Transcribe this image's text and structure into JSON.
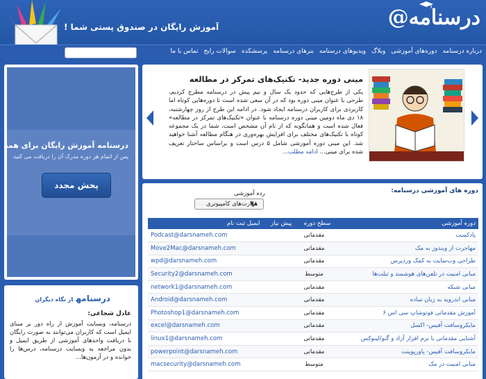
{
  "header": {
    "logo_text": "درسنامه",
    "logo_at": "@",
    "tagline": "آموزش رایگان در صندوق پستی شما !"
  },
  "nav": {
    "items": [
      "درباره درسنامه",
      "دوره‌های آموزشی",
      "وبلاگ",
      "ویدیوهای درسنامه",
      "بنرهای درسنامه",
      "پرسشکده",
      "سوالات رایج",
      "تماس با ما"
    ]
  },
  "promo": {
    "title": "درسنامه آموزش رایگان برای همه !",
    "subtitle": "پس از اتمام هر دوره مدرک آن را دریافت می کنید",
    "button_label": "پخش مجدد"
  },
  "testimonial": {
    "heading": "درسنامه",
    "heading_suffix": "از نگاه دیگران",
    "author": "عادل شجاعی:",
    "body": "درسنامه، وبسایت آموزش از راه دور بر مبنای ایمیل است که کاربران می‌توانند به صورت رایگان با دریافت واحدهای آموزشی از طریق ایمیل و بدون مراجعه به وبسایت درسنامه، درس‌ها را خوانده و در آزمون‌ها..."
  },
  "feature": {
    "title": "مینی دوره جدید- تکنیک‌های تمرکز در مطالعه",
    "body": "یکی از طرح‌هایی که حدود یک سال و نیم پیش در درسنامه مطرح کردیم، طرحی با عنوان مینی دوره بود که در آن سعی شده است تا دوره‌هایی کوتاه اما کاربردی برای کاربران درسنامه ایجاد شود. در ادامه این طرح از روز چهارشنبه، ۱۸ دی ماه دومین مینی دوره درسنامه با عنوان «تکنیک‌های تمرکز در مطالعه» فعال شده است و همانگونه که از نام آن مشخص است، شما در یک مجموعه کوتاه با تکنیک‌های مختلف برای افزایش بهره‌وری در هنگام مطالعه آشنا خواهید شد. این مینی دوره آموزشی شامل ۵ درس است و براساس ساختار تعریف شده برای مینی...",
    "more_link": "ادامه مطلب..."
  },
  "courses": {
    "title": "دوره های آموزشی درسنامه:",
    "level_label": "رده آموزشی",
    "level_selected": "مهارت‌های کامپیوتری",
    "headers": [
      "دوره آموزشی",
      "سطح دوره",
      "پیش نیاز",
      "ایمیل ثبت نام"
    ],
    "rows": [
      {
        "name": "پادکست",
        "level": "مقدماتی",
        "email": "Podcast@darsnameh.com"
      },
      {
        "name": "مهاجرت از ویندوز به مک",
        "level": "مقدماتی",
        "email": "Move2Mac@darsnameh.com"
      },
      {
        "name": "طراحی وب‌سایت به کمک وردپرس",
        "level": "مقدماتی",
        "email": "wpd@darsnameh.com"
      },
      {
        "name": "مبانی امنیت در تلفن‌های هوشمند و تبلت‌ها",
        "level": "متوسط",
        "email": "Security2@darsnameh.com"
      },
      {
        "name": "مبانی شبکه",
        "level": "مقدماتی",
        "email": "network1@darsnameh.com"
      },
      {
        "name": "مبانی اندروید به زبان ساده",
        "level": "مقدماتی",
        "email": "Android@darsnameh.com"
      },
      {
        "name": "آموزش مقدماتی فوتوشاپ سی اس ۶",
        "level": "مقدماتی",
        "email": "Photoshop1@darsnameh.com"
      },
      {
        "name": "مایکروسافت آفیس- اکسل",
        "level": "مقدماتی",
        "email": "excel@darsnameh.com"
      },
      {
        "name": "آشنایی مقدماتی با نرم افزار آزاد و گنو/لینوکس",
        "level": "مقدماتی",
        "email": "linux1@darsnameh.com"
      },
      {
        "name": "مایکروسافت آفیس- پاورپوینت",
        "level": "مقدماتی",
        "email": "powerpoint@darsnameh.com"
      },
      {
        "name": "مبانی امنیت در مک",
        "level": "متوسط",
        "email": "macsecurity@darsnameh.com"
      }
    ]
  }
}
